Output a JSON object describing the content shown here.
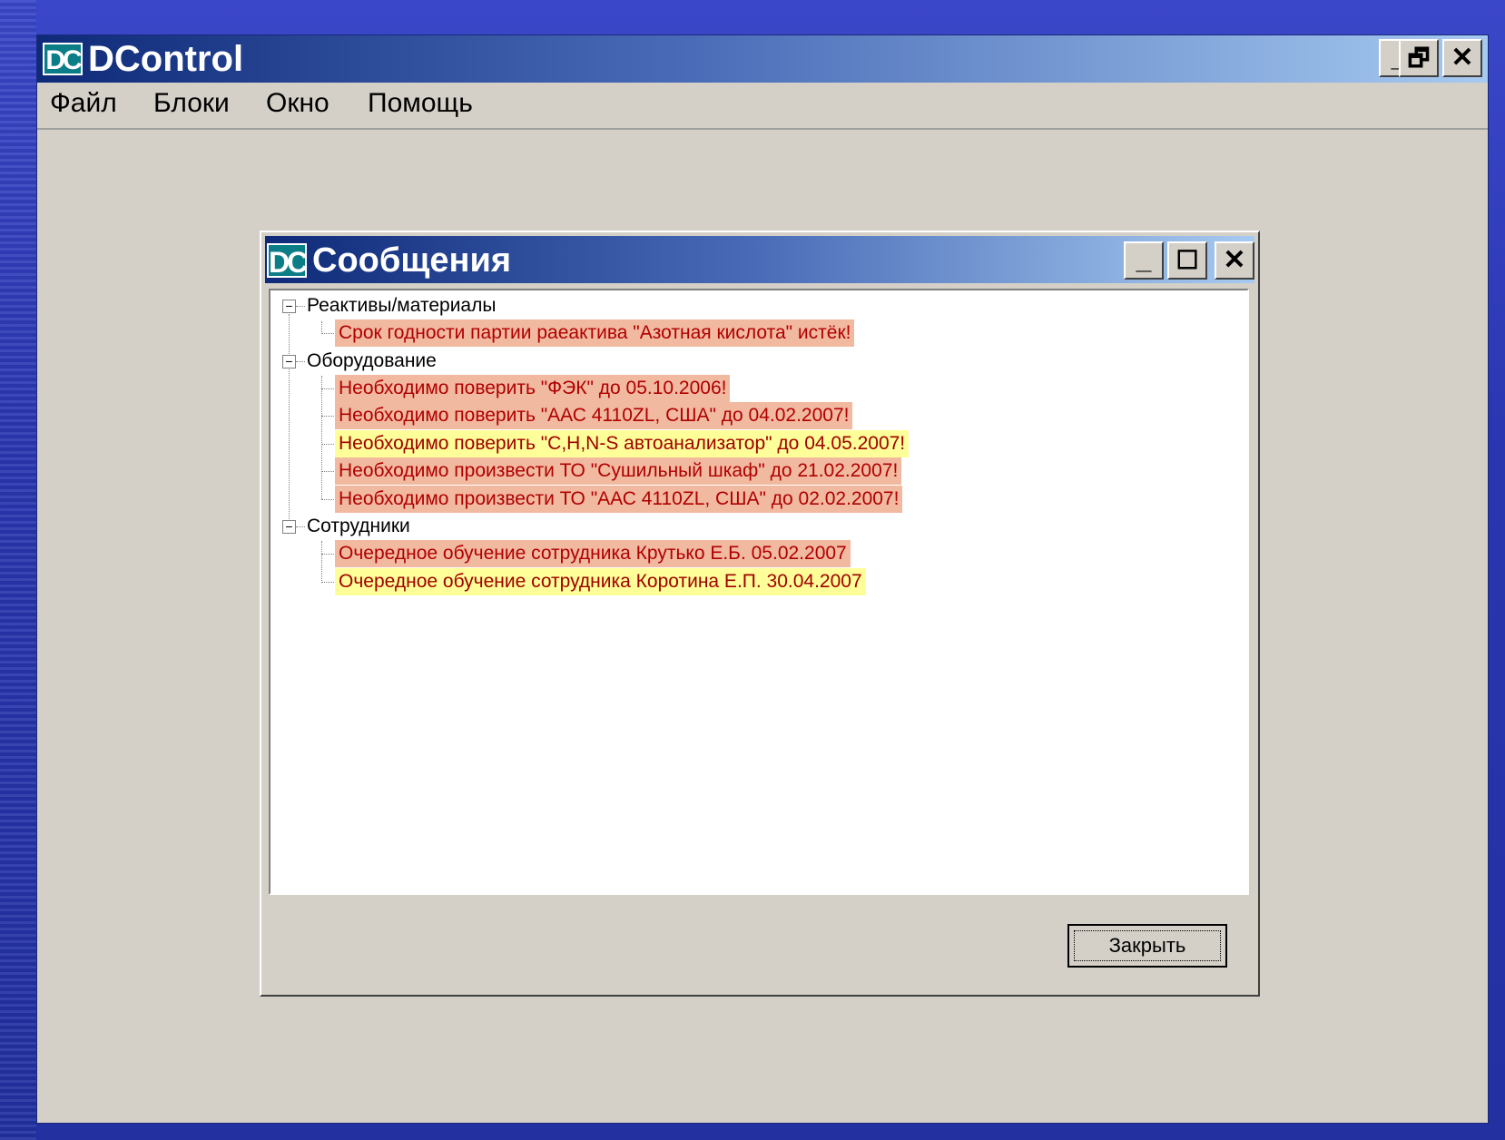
{
  "app": {
    "title": "DControl",
    "logo_text": "DC",
    "controls": {
      "minimize": "_",
      "restore": "🗗",
      "close": "✕"
    }
  },
  "menu": {
    "items": [
      {
        "label": "Файл"
      },
      {
        "label": "Блоки"
      },
      {
        "label": "Окно"
      },
      {
        "label": "Помощь"
      }
    ]
  },
  "dialog": {
    "title": "Сообщения",
    "logo_text": "DC",
    "controls": {
      "minimize": "_",
      "maximize": "☐",
      "close": "✕"
    },
    "close_button_label": "Закрыть",
    "groups": [
      {
        "label": "Реактивы/материалы",
        "items": [
          {
            "text": "Срок годности партии раеактива \"Азотная кислота\" истёк!",
            "status": "red"
          }
        ]
      },
      {
        "label": "Оборудование",
        "items": [
          {
            "text": "Необходимо поверить \"ФЭК\" до 05.10.2006!",
            "status": "red"
          },
          {
            "text": "Необходимо поверить \"ААС 4110ZL, США\" до 04.02.2007!",
            "status": "red"
          },
          {
            "text": "Необходимо поверить \"C,H,N-S автоанализатор\" до 04.05.2007!",
            "status": "yellow"
          },
          {
            "text": "Необходимо произвести ТО \"Сушильный шкаф\" до 21.02.2007!",
            "status": "red"
          },
          {
            "text": "Необходимо произвести ТО \"ААС 4110ZL, США\" до 02.02.2007!",
            "status": "red"
          }
        ]
      },
      {
        "label": "Сотрудники",
        "items": [
          {
            "text": "Очередное обучение сотрудника Крутько  Е.Б. 05.02.2007",
            "status": "red"
          },
          {
            "text": "Очередное обучение сотрудника Коротина Е.П. 30.04.2007",
            "status": "yellow"
          }
        ]
      }
    ]
  },
  "colors": {
    "red_bg": "#f2b9a1",
    "yellow_bg": "#ffff99",
    "message_text": "#b00000"
  }
}
